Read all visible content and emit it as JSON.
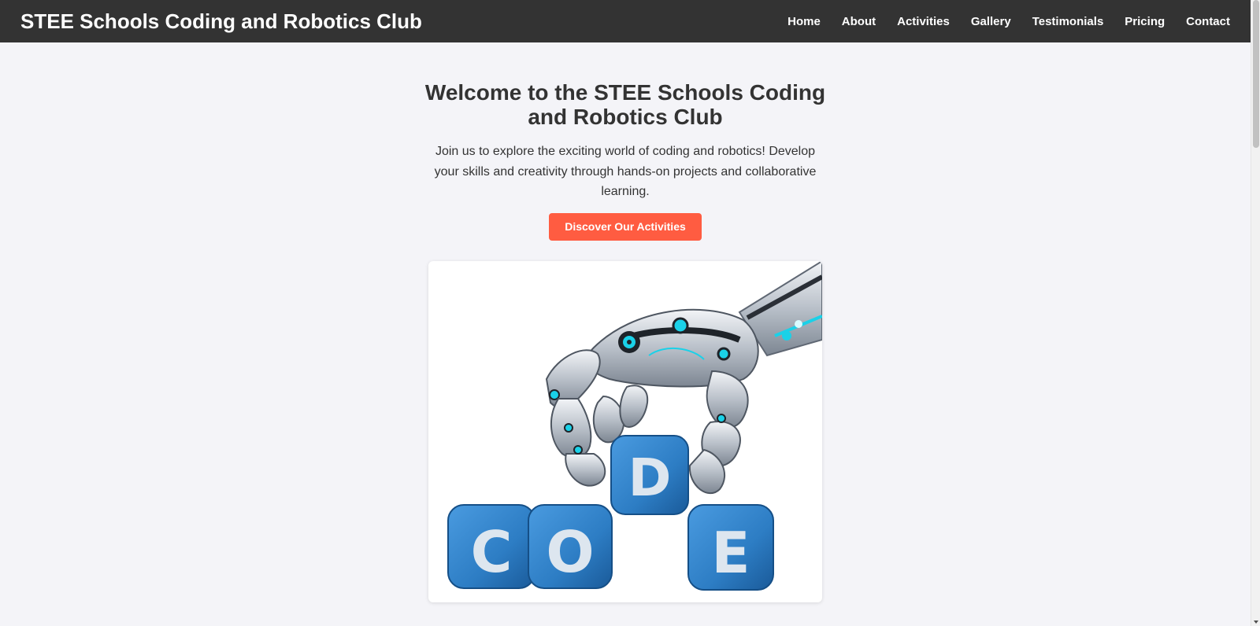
{
  "header": {
    "brand": "STEE Schools Coding and Robotics Club",
    "nav": [
      {
        "label": "Home"
      },
      {
        "label": "About"
      },
      {
        "label": "Activities"
      },
      {
        "label": "Gallery"
      },
      {
        "label": "Testimonials"
      },
      {
        "label": "Pricing"
      },
      {
        "label": "Contact"
      }
    ]
  },
  "hero": {
    "title": "Welcome to the STEE Schools Coding and Robotics Club",
    "text": "Join us to explore the exciting world of coding and robotics! Develop your skills and creativity through hands-on projects and collaborative learning.",
    "cta_label": "Discover Our Activities",
    "image": {
      "blocks": [
        "C",
        "O",
        "D",
        "E"
      ]
    }
  },
  "colors": {
    "navbar": "#333333",
    "page_bg": "#f4f4f8",
    "accent": "#ff5c41",
    "block_blue": "#2d7dc4"
  }
}
